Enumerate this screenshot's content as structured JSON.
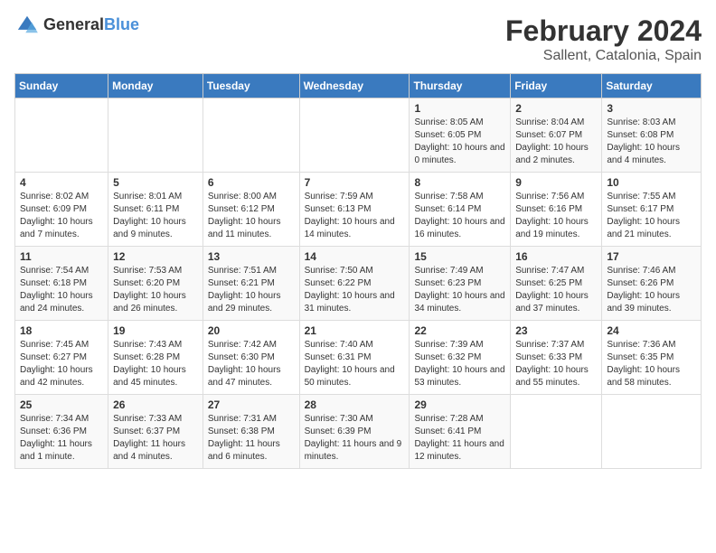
{
  "header": {
    "logo_general": "General",
    "logo_blue": "Blue",
    "title": "February 2024",
    "location": "Sallent, Catalonia, Spain"
  },
  "weekdays": [
    "Sunday",
    "Monday",
    "Tuesday",
    "Wednesday",
    "Thursday",
    "Friday",
    "Saturday"
  ],
  "weeks": [
    [
      {
        "day": "",
        "info": ""
      },
      {
        "day": "",
        "info": ""
      },
      {
        "day": "",
        "info": ""
      },
      {
        "day": "",
        "info": ""
      },
      {
        "day": "1",
        "info": "Sunrise: 8:05 AM\nSunset: 6:05 PM\nDaylight: 10 hours\nand 0 minutes."
      },
      {
        "day": "2",
        "info": "Sunrise: 8:04 AM\nSunset: 6:07 PM\nDaylight: 10 hours\nand 2 minutes."
      },
      {
        "day": "3",
        "info": "Sunrise: 8:03 AM\nSunset: 6:08 PM\nDaylight: 10 hours\nand 4 minutes."
      }
    ],
    [
      {
        "day": "4",
        "info": "Sunrise: 8:02 AM\nSunset: 6:09 PM\nDaylight: 10 hours\nand 7 minutes."
      },
      {
        "day": "5",
        "info": "Sunrise: 8:01 AM\nSunset: 6:11 PM\nDaylight: 10 hours\nand 9 minutes."
      },
      {
        "day": "6",
        "info": "Sunrise: 8:00 AM\nSunset: 6:12 PM\nDaylight: 10 hours\nand 11 minutes."
      },
      {
        "day": "7",
        "info": "Sunrise: 7:59 AM\nSunset: 6:13 PM\nDaylight: 10 hours\nand 14 minutes."
      },
      {
        "day": "8",
        "info": "Sunrise: 7:58 AM\nSunset: 6:14 PM\nDaylight: 10 hours\nand 16 minutes."
      },
      {
        "day": "9",
        "info": "Sunrise: 7:56 AM\nSunset: 6:16 PM\nDaylight: 10 hours\nand 19 minutes."
      },
      {
        "day": "10",
        "info": "Sunrise: 7:55 AM\nSunset: 6:17 PM\nDaylight: 10 hours\nand 21 minutes."
      }
    ],
    [
      {
        "day": "11",
        "info": "Sunrise: 7:54 AM\nSunset: 6:18 PM\nDaylight: 10 hours\nand 24 minutes."
      },
      {
        "day": "12",
        "info": "Sunrise: 7:53 AM\nSunset: 6:20 PM\nDaylight: 10 hours\nand 26 minutes."
      },
      {
        "day": "13",
        "info": "Sunrise: 7:51 AM\nSunset: 6:21 PM\nDaylight: 10 hours\nand 29 minutes."
      },
      {
        "day": "14",
        "info": "Sunrise: 7:50 AM\nSunset: 6:22 PM\nDaylight: 10 hours\nand 31 minutes."
      },
      {
        "day": "15",
        "info": "Sunrise: 7:49 AM\nSunset: 6:23 PM\nDaylight: 10 hours\nand 34 minutes."
      },
      {
        "day": "16",
        "info": "Sunrise: 7:47 AM\nSunset: 6:25 PM\nDaylight: 10 hours\nand 37 minutes."
      },
      {
        "day": "17",
        "info": "Sunrise: 7:46 AM\nSunset: 6:26 PM\nDaylight: 10 hours\nand 39 minutes."
      }
    ],
    [
      {
        "day": "18",
        "info": "Sunrise: 7:45 AM\nSunset: 6:27 PM\nDaylight: 10 hours\nand 42 minutes."
      },
      {
        "day": "19",
        "info": "Sunrise: 7:43 AM\nSunset: 6:28 PM\nDaylight: 10 hours\nand 45 minutes."
      },
      {
        "day": "20",
        "info": "Sunrise: 7:42 AM\nSunset: 6:30 PM\nDaylight: 10 hours\nand 47 minutes."
      },
      {
        "day": "21",
        "info": "Sunrise: 7:40 AM\nSunset: 6:31 PM\nDaylight: 10 hours\nand 50 minutes."
      },
      {
        "day": "22",
        "info": "Sunrise: 7:39 AM\nSunset: 6:32 PM\nDaylight: 10 hours\nand 53 minutes."
      },
      {
        "day": "23",
        "info": "Sunrise: 7:37 AM\nSunset: 6:33 PM\nDaylight: 10 hours\nand 55 minutes."
      },
      {
        "day": "24",
        "info": "Sunrise: 7:36 AM\nSunset: 6:35 PM\nDaylight: 10 hours\nand 58 minutes."
      }
    ],
    [
      {
        "day": "25",
        "info": "Sunrise: 7:34 AM\nSunset: 6:36 PM\nDaylight: 11 hours\nand 1 minute."
      },
      {
        "day": "26",
        "info": "Sunrise: 7:33 AM\nSunset: 6:37 PM\nDaylight: 11 hours\nand 4 minutes."
      },
      {
        "day": "27",
        "info": "Sunrise: 7:31 AM\nSunset: 6:38 PM\nDaylight: 11 hours\nand 6 minutes."
      },
      {
        "day": "28",
        "info": "Sunrise: 7:30 AM\nSunset: 6:39 PM\nDaylight: 11 hours\nand 9 minutes."
      },
      {
        "day": "29",
        "info": "Sunrise: 7:28 AM\nSunset: 6:41 PM\nDaylight: 11 hours\nand 12 minutes."
      },
      {
        "day": "",
        "info": ""
      },
      {
        "day": "",
        "info": ""
      }
    ]
  ]
}
